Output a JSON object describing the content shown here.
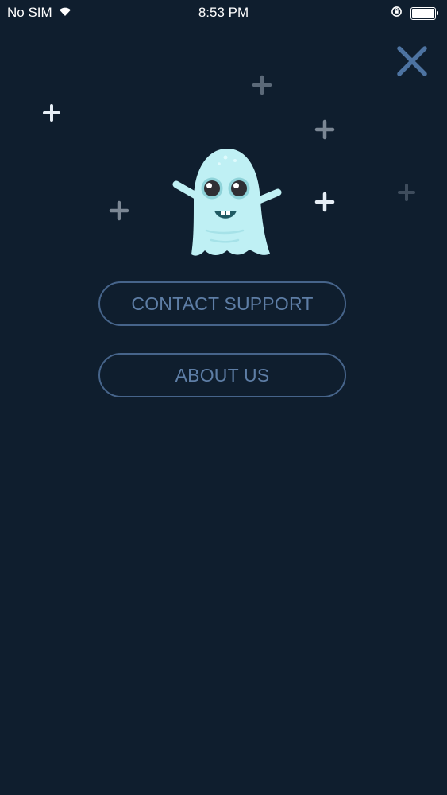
{
  "status_bar": {
    "carrier": "No SIM",
    "time": "8:53 PM",
    "icons": [
      "wifi-icon",
      "orientation-lock-icon",
      "battery-icon"
    ],
    "battery_level": 1.0
  },
  "close_button": {
    "icon": "close-icon"
  },
  "menu": {
    "contact_support_label": "CONTACT SUPPORT",
    "about_us_label": "ABOUT US"
  },
  "illustration": {
    "icon": "ghost-mascot-icon",
    "decorations": "sparkle-icon"
  },
  "colors": {
    "background": "#0f1e2e",
    "button_outline": "#46648a",
    "button_text": "#5e7ea6",
    "close_icon": "#4d73a1",
    "ghost_body": "#bff0f4"
  }
}
